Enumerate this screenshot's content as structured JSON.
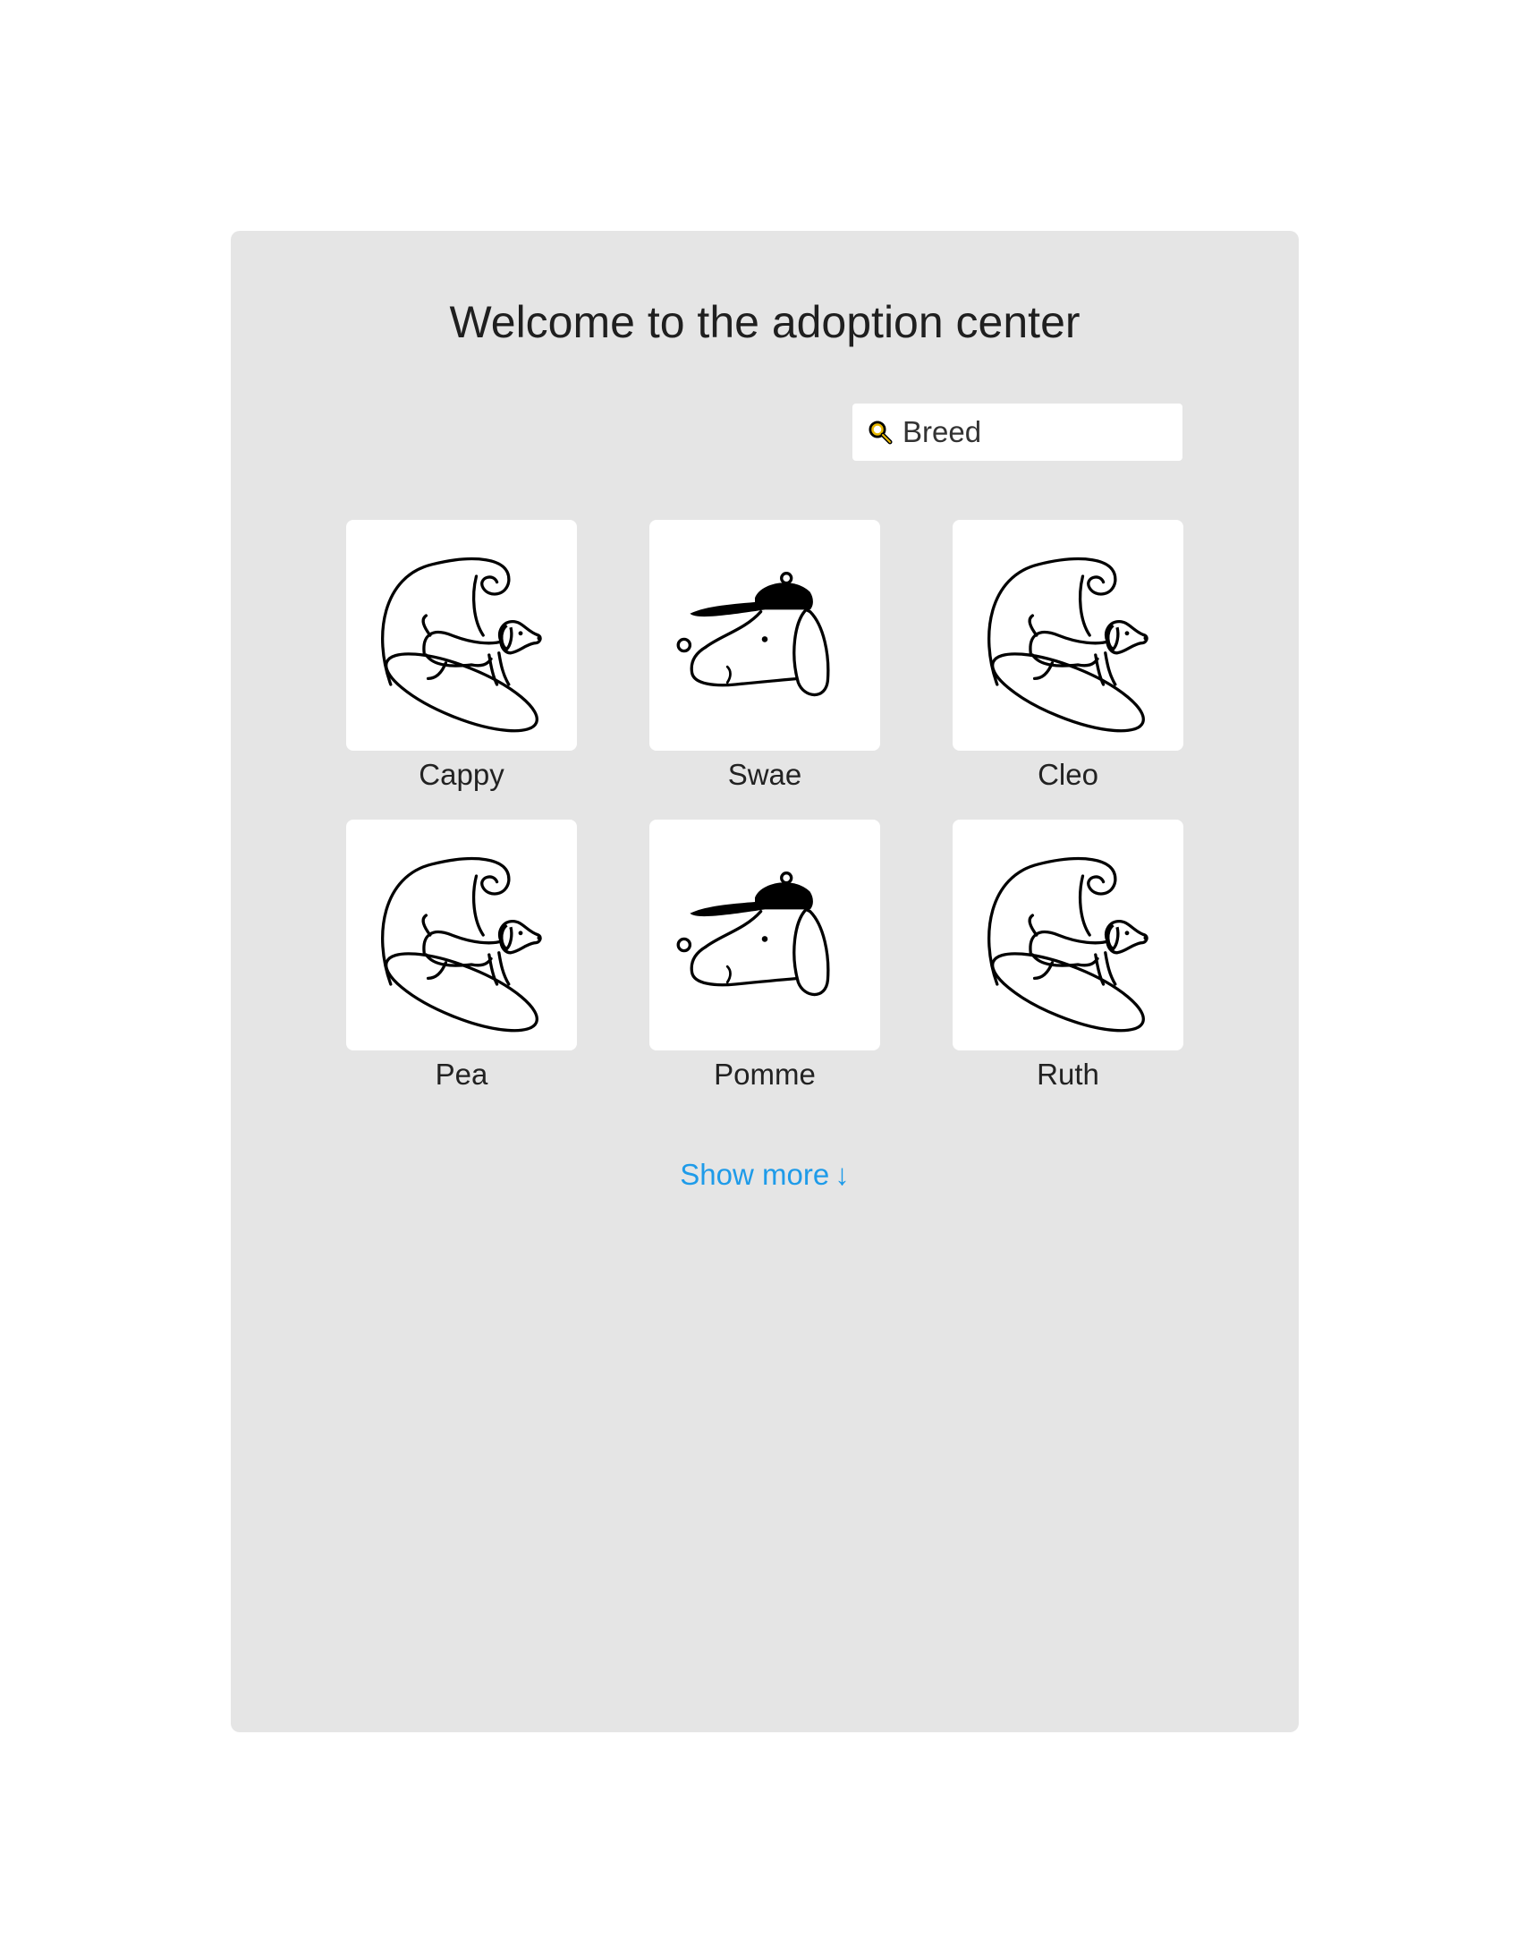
{
  "page": {
    "title": "Welcome to the adoption center"
  },
  "search": {
    "placeholder": "Breed",
    "icon": "magnifier-icon",
    "icon_color": "#e8b800"
  },
  "pets": [
    {
      "name": "Cappy",
      "image": "surfing-dog"
    },
    {
      "name": "Swae",
      "image": "dog-with-cap"
    },
    {
      "name": "Cleo",
      "image": "surfing-dog"
    },
    {
      "name": "Pea",
      "image": "surfing-dog"
    },
    {
      "name": "Pomme",
      "image": "dog-with-cap"
    },
    {
      "name": "Ruth",
      "image": "surfing-dog"
    }
  ],
  "show_more": {
    "label": "Show more",
    "icon": "↓"
  },
  "colors": {
    "panel_bg": "#e5e5e5",
    "link": "#1e9be9"
  }
}
